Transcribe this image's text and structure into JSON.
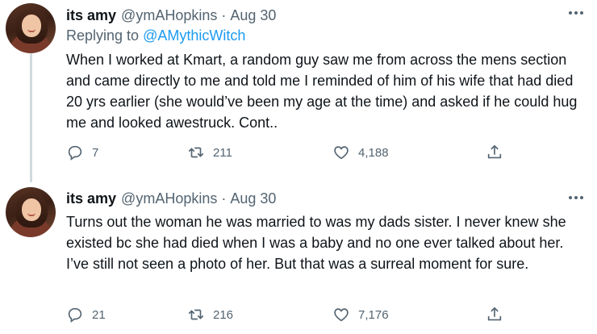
{
  "tweets": [
    {
      "author_name": "its amy",
      "handle": "@ymAHopkins",
      "separator": "·",
      "date": "Aug 30",
      "replying_prefix": "Replying to",
      "replying_mention": "@AMythicWitch",
      "text": "When I worked at Kmart, a random guy saw me from across the mens section and came directly to me and told me I reminded of him of his wife that had died 20 yrs earlier (she would’ve been my age at the time) and asked if he could hug me and looked awestruck. Cont..",
      "replies": "7",
      "retweets": "211",
      "likes": "4,188",
      "icons": [
        "reply-icon",
        "retweet-icon",
        "like-icon",
        "share-icon",
        "more-icon"
      ]
    },
    {
      "author_name": "its amy",
      "handle": "@ymAHopkins",
      "separator": "·",
      "date": "Aug 30",
      "text": "Turns out the woman he was married to was my dads sister. I never knew she existed bc she had died when I was a baby and no one ever talked about her. I’ve still not seen a photo of her. But that was a surreal moment for sure.",
      "replies": "21",
      "retweets": "216",
      "likes": "7,176",
      "icons": [
        "reply-icon",
        "retweet-icon",
        "like-icon",
        "share-icon",
        "more-icon"
      ]
    }
  ],
  "colors": {
    "text": "#0f1419",
    "secondary": "#536471",
    "link": "#1d9bf0",
    "thread_line": "#cfd9de"
  }
}
